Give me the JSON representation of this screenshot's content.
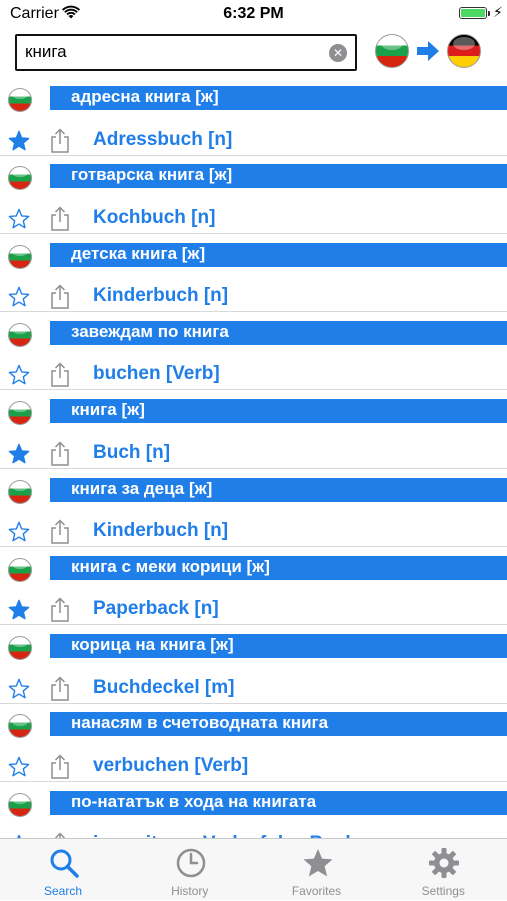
{
  "status_bar": {
    "carrier": "Carrier",
    "time": "6:32 PM"
  },
  "search": {
    "value": "книга"
  },
  "language": {
    "from": "Bulgarian flag",
    "to": "German flag",
    "arrow_color": "#1f7ee8"
  },
  "colors": {
    "accent": "#1f7ee8",
    "inactive": "#8e8e93"
  },
  "results": [
    {
      "bg": "адресна книга [ж]",
      "de": "Adressbuch [n]",
      "favorite": true
    },
    {
      "bg": "готварска книга [ж]",
      "de": "Kochbuch [n]",
      "favorite": false
    },
    {
      "bg": "детска книга [ж]",
      "de": "Kinderbuch [n]",
      "favorite": false
    },
    {
      "bg": "завеждам по книга",
      "de": "buchen [Verb]",
      "favorite": false
    },
    {
      "bg": "книга [ж]",
      "de": "Buch [n]",
      "favorite": true
    },
    {
      "bg": "книга за деца [ж]",
      "de": "Kinderbuch [n]",
      "favorite": false
    },
    {
      "bg": "книга с меки корици [ж]",
      "de": "Paperback [n]",
      "favorite": true
    },
    {
      "bg": "корица на книга [ж]",
      "de": "Buchdeckel [m]",
      "favorite": false
    },
    {
      "bg": "нанасям в счетоводната книга",
      "de": "verbuchen [Verb]",
      "favorite": false
    },
    {
      "bg": "по-нататък в хода на книгата",
      "de": "im weiteren Verlauf des Buches",
      "favorite": true
    }
  ],
  "tabs": [
    {
      "label": "Search",
      "icon": "search-icon",
      "active": true
    },
    {
      "label": "History",
      "icon": "clock-icon",
      "active": false
    },
    {
      "label": "Favorites",
      "icon": "star-icon",
      "active": false
    },
    {
      "label": "Settings",
      "icon": "gear-icon",
      "active": false
    }
  ]
}
